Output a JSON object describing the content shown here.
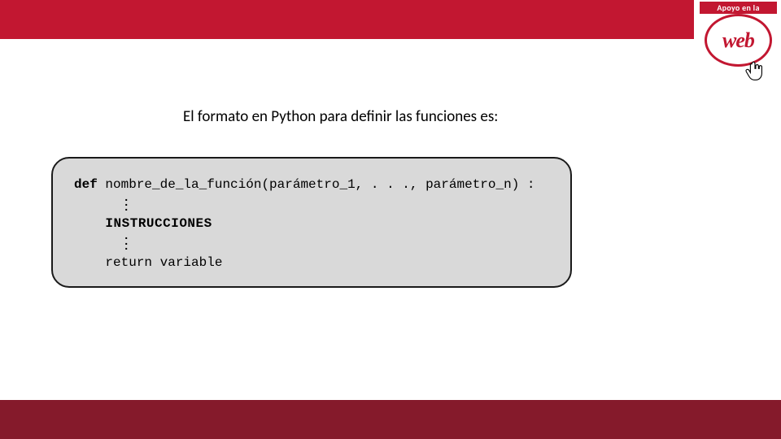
{
  "logo": {
    "top_text": "Apoyo en la",
    "web_text": "web"
  },
  "heading": "El formato en Python para definir las funciones es:",
  "code": {
    "kw_def": "def",
    "func_sig": " nombre_de_la_función(parámetro_1, . . ., parámetro_n) :",
    "instr": "INSTRUCCIONES",
    "kw_return": "return",
    "ret_var": " variable"
  }
}
